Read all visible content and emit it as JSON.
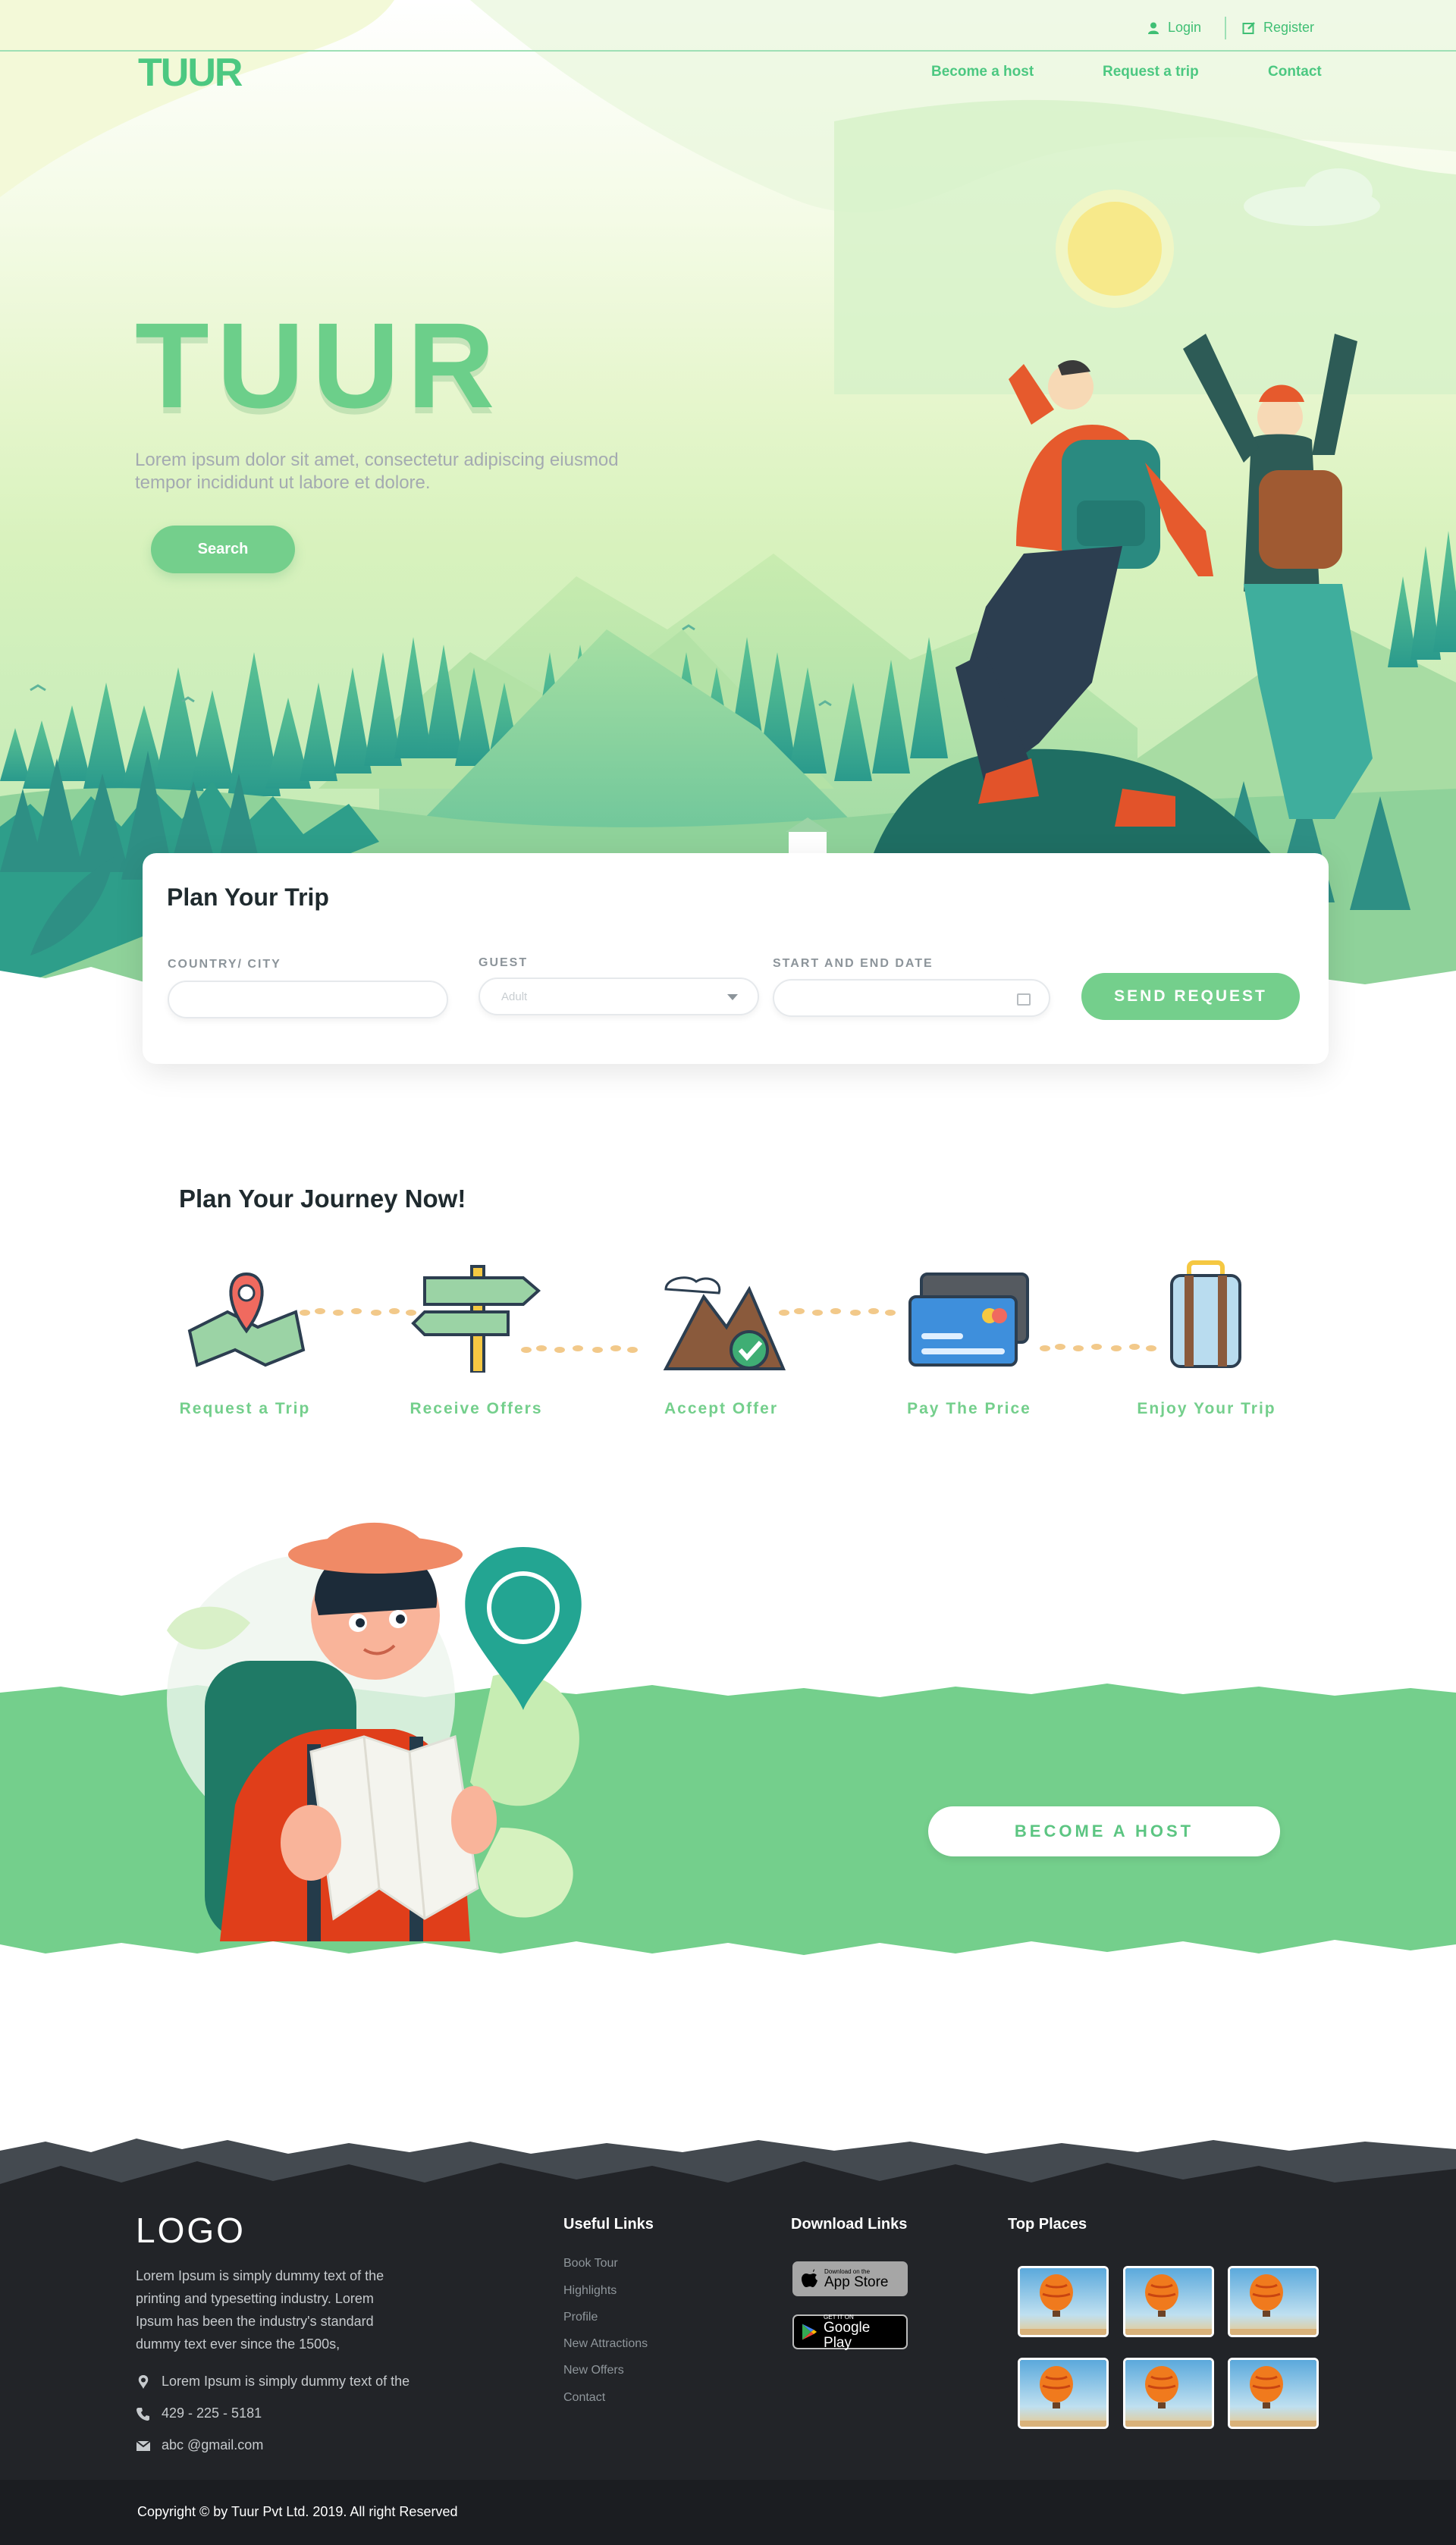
{
  "colors": {
    "accent": "#74cf8c",
    "accent_dark": "#3fbf74",
    "footer_bg": "#222428",
    "text_dark": "#1f2a2e"
  },
  "topbar": {
    "login_label": "Login",
    "register_label": "Register",
    "login_icon": "user-icon",
    "register_icon": "edit-icon"
  },
  "header": {
    "logo": "TUUR",
    "nav": [
      "Become a host",
      "Request a trip",
      "Contact"
    ]
  },
  "hero": {
    "title": "TUUR",
    "subtitle": "Lorem ipsum dolor sit amet, consectetur adipiscing eiusmod tempor incididunt ut labore et dolore.",
    "search_label": "Search"
  },
  "plan": {
    "title": "Plan Your Trip",
    "country_label": "COUNTRY/ CITY",
    "country_value": "",
    "guest_label": "GUEST",
    "guest_selected": "Adult",
    "date_label": "START AND END DATE",
    "date_value": "",
    "send_label": "SEND REQUEST"
  },
  "journey": {
    "title": "Plan Your Journey Now!",
    "steps": [
      {
        "label": "Request a Trip",
        "icon": "map-pin-icon"
      },
      {
        "label": "Receive Offers",
        "icon": "signpost-icon"
      },
      {
        "label": "Accept Offer",
        "icon": "mountain-check-icon"
      },
      {
        "label": "Pay The Price",
        "icon": "credit-card-icon"
      },
      {
        "label": "Enjoy Your Trip",
        "icon": "suitcase-icon"
      }
    ]
  },
  "host": {
    "button_label": "BECOME A HOST"
  },
  "footer": {
    "logo": "LOGO",
    "description": "Lorem Ipsum is simply dummy text of the printing and typesetting industry. Lorem Ipsum has been the industry's standard dummy text ever since the 1500s,",
    "address": "Lorem Ipsum is simply dummy text of the",
    "phone": "429 - 225 - 5181",
    "email": "abc @gmail.com",
    "useful_links_title": "Useful Links",
    "useful_links": [
      "Book Tour",
      "Highlights",
      "Profile",
      "New Attractions",
      "New Offers",
      "Contact"
    ],
    "download_title": "Download Links",
    "app_store": {
      "small": "Download on the",
      "big": "App Store"
    },
    "google_play": {
      "small": "GET IT ON",
      "big": "Google Play"
    },
    "top_places_title": "Top Places",
    "copyright": "Copyright © by Tuur Pvt Ltd. 2019. All right Reserved"
  }
}
